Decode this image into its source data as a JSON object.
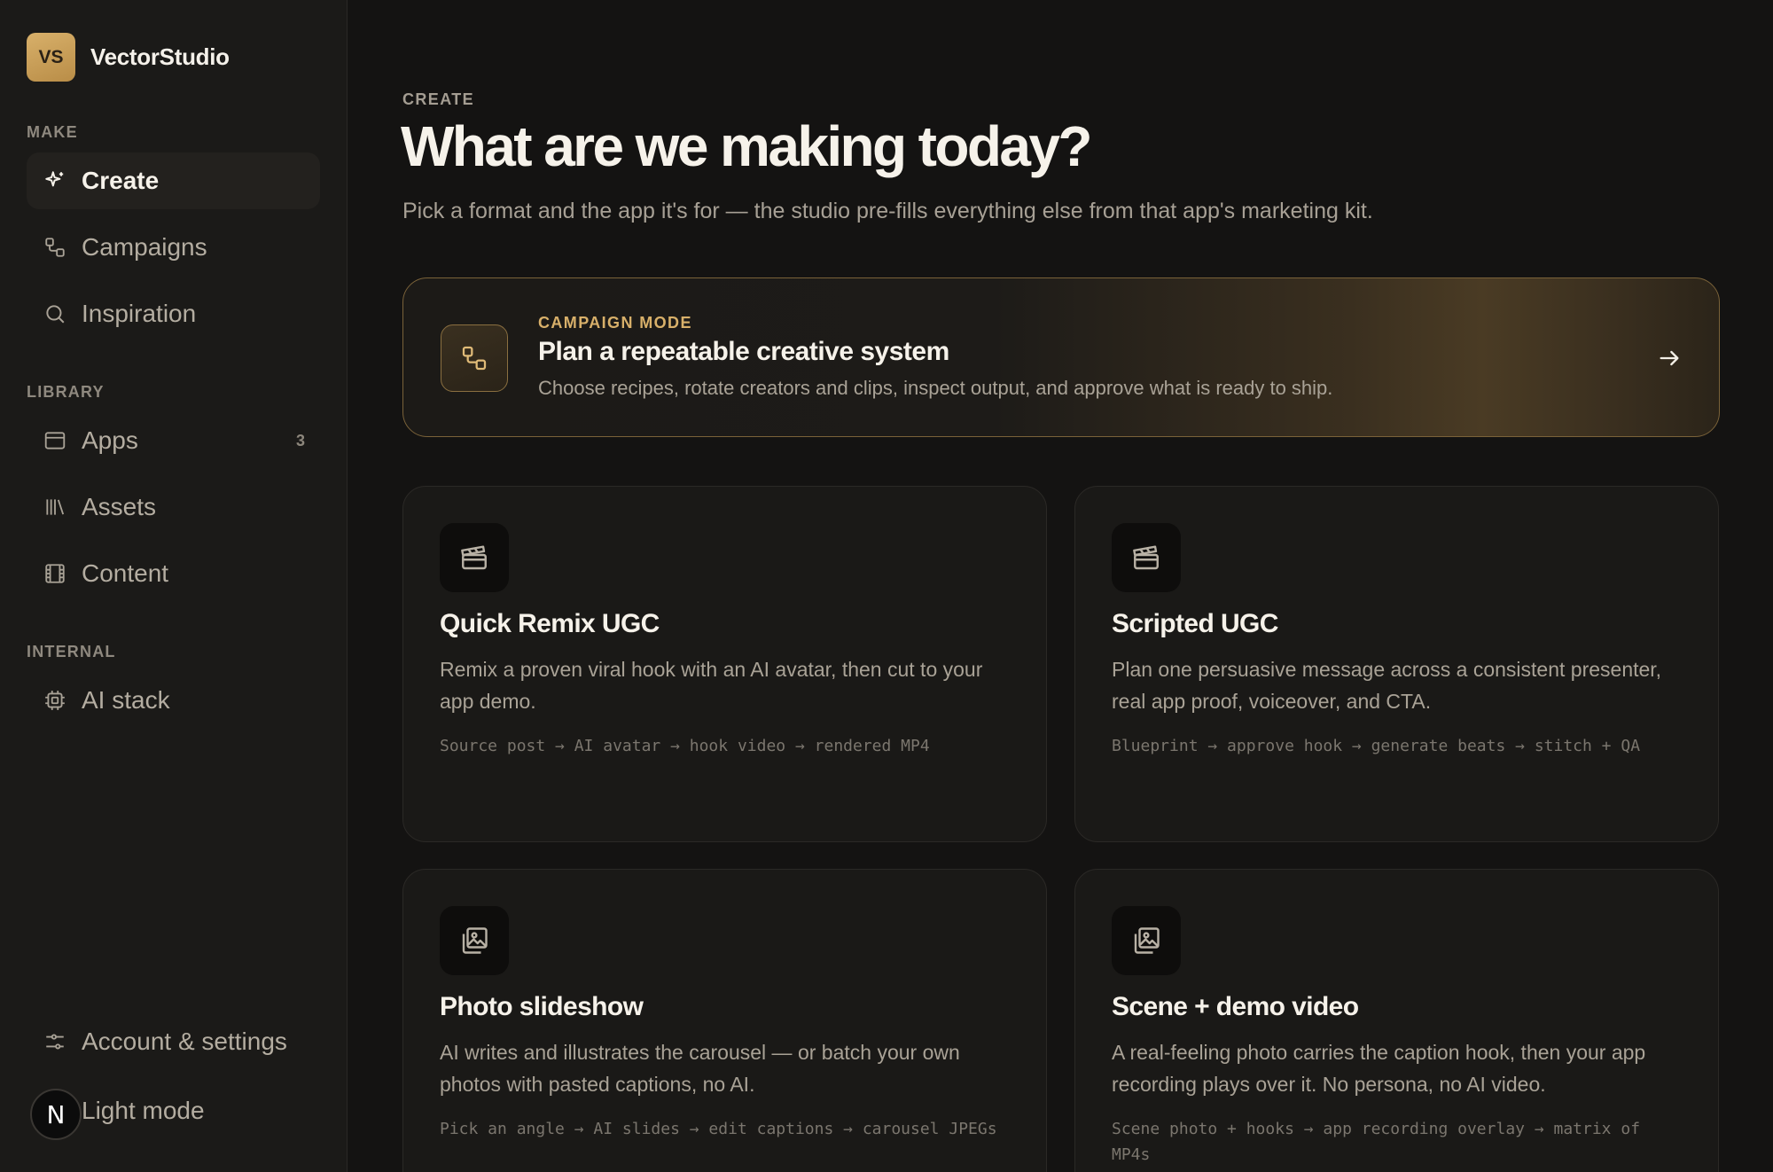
{
  "brand": {
    "initials": "VS",
    "name": "VectorStudio"
  },
  "sidebar": {
    "sections": {
      "make": "MAKE",
      "library": "LIBRARY",
      "internal": "INTERNAL"
    },
    "items": [
      {
        "label": "Create",
        "icon": "sparkle-icon",
        "active": true
      },
      {
        "label": "Campaigns",
        "icon": "workflow-icon"
      },
      {
        "label": "Inspiration",
        "icon": "search-icon"
      },
      {
        "label": "Apps",
        "icon": "browser-window-icon",
        "count": "3"
      },
      {
        "label": "Assets",
        "icon": "library-icon"
      },
      {
        "label": "Content",
        "icon": "film-icon"
      },
      {
        "label": "AI stack",
        "icon": "chip-icon"
      }
    ],
    "footer": {
      "settings_label": "Account & settings",
      "settings_icon": "sliders-icon",
      "theme_label": "Light mode",
      "user_initial": "N"
    }
  },
  "main": {
    "eyebrow": "CREATE",
    "title": "What are we making today?",
    "subtitle": "Pick a format and the app it's for — the studio pre-fills everything else from that app's marketing kit.",
    "campaign": {
      "eyebrow": "CAMPAIGN MODE",
      "title": "Plan a repeatable creative system",
      "description": "Choose recipes, rotate creators and clips, inspect output, and approve what is ready to ship."
    },
    "cards": [
      {
        "title": "Quick Remix UGC",
        "description": "Remix a proven viral hook with an AI avatar, then cut to your app demo.",
        "flow": "Source post → AI avatar → hook video → rendered MP4",
        "icon": "clapperboard-icon"
      },
      {
        "title": "Scripted UGC",
        "description": "Plan one persuasive message across a consistent presenter, real app proof, voiceover, and CTA.",
        "flow": "Blueprint → approve hook → generate beats → stitch + QA",
        "icon": "clapperboard-icon"
      },
      {
        "title": "Photo slideshow",
        "description": "AI writes and illustrates the carousel — or batch your own photos with pasted captions, no AI.",
        "flow": "Pick an angle → AI slides → edit captions → carousel JPEGs",
        "icon": "image-stack-icon"
      },
      {
        "title": "Scene + demo video",
        "description": "A real-feeling photo carries the caption hook, then your app recording plays over it. No persona, no AI video.",
        "flow": "Scene photo + hooks → app recording overlay → matrix of MP4s",
        "icon": "image-stack-icon"
      }
    ]
  },
  "colors": {
    "accent": "#d8b06a",
    "background": "#141312",
    "sidebar": "#1b1a18",
    "card": "#1a1917"
  }
}
